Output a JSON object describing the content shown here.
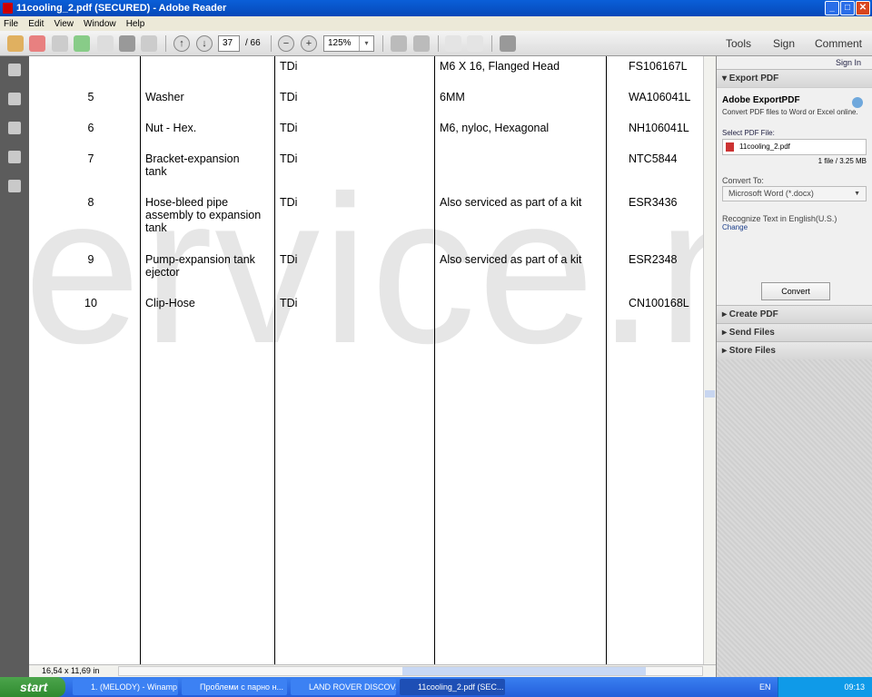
{
  "window": {
    "title": "11cooling_2.pdf (SECURED) - Adobe Reader",
    "minimize": "_",
    "maximize": "□",
    "close": "✕"
  },
  "menu": [
    "File",
    "Edit",
    "View",
    "Window",
    "Help"
  ],
  "toolbar": {
    "page_current": "37",
    "page_total": "/ 66",
    "zoom": "125%",
    "zoom_dropdown": "▾",
    "prev": "↑",
    "next": "↓",
    "zoom_out": "−",
    "zoom_in": "+",
    "tools": "Tools",
    "sign": "Sign",
    "comment": "Comment"
  },
  "document": {
    "watermark": "ervice.n",
    "rows": [
      {
        "num": "",
        "part": "",
        "engine": "TDi",
        "remarks": "M6 X 16, Flanged Head",
        "code": "FS106167L"
      },
      {
        "num": "5",
        "part": "Washer",
        "engine": "TDi",
        "remarks": "6MM",
        "code": "WA106041L"
      },
      {
        "num": "6",
        "part": "Nut - Hex.",
        "engine": "TDi",
        "remarks": "M6, nyloc, Hexagonal",
        "code": "NH106041L"
      },
      {
        "num": "7",
        "part": "Bracket-expansion tank",
        "engine": "TDi",
        "remarks": "",
        "code": "NTC5844"
      },
      {
        "num": "8",
        "part": "Hose-bleed pipe assembly to expansion tank",
        "engine": "TDi",
        "remarks": "Also serviced as part of a kit",
        "code": "ESR3436"
      },
      {
        "num": "9",
        "part": "Pump-expansion tank ejector",
        "engine": "TDi",
        "remarks": "Also serviced as part of a kit",
        "code": "ESR2348"
      },
      {
        "num": "10",
        "part": "Clip-Hose",
        "engine": "TDi",
        "remarks": "",
        "code": "CN100168L"
      }
    ],
    "page_size": "16,54 x 11,69 in"
  },
  "panel": {
    "sign_in": "Sign In",
    "export_header": "▾ Export PDF",
    "export_title": "Adobe ExportPDF",
    "export_desc": "Convert PDF files to Word or Excel online.",
    "select_label": "Select PDF File:",
    "file_name": "11cooling_2.pdf",
    "file_info": "1 file / 3.25 MB",
    "convert_to_label": "Convert To:",
    "convert_to_value": "Microsoft Word (*.docx)",
    "recognize": "Recognize Text in English(U.S.)",
    "change": "Change",
    "convert_btn": "Convert",
    "sections": [
      "▸ Create PDF",
      "▸ Send Files",
      "▸ Store Files"
    ]
  },
  "taskbar": {
    "start": "start",
    "tasks": [
      "1. (MELODY) - Winamp",
      "Проблеми с парно н...",
      "LAND ROVER DISCOV...",
      "11cooling_2.pdf (SEC..."
    ],
    "lang": "EN",
    "clock": "09:13"
  }
}
